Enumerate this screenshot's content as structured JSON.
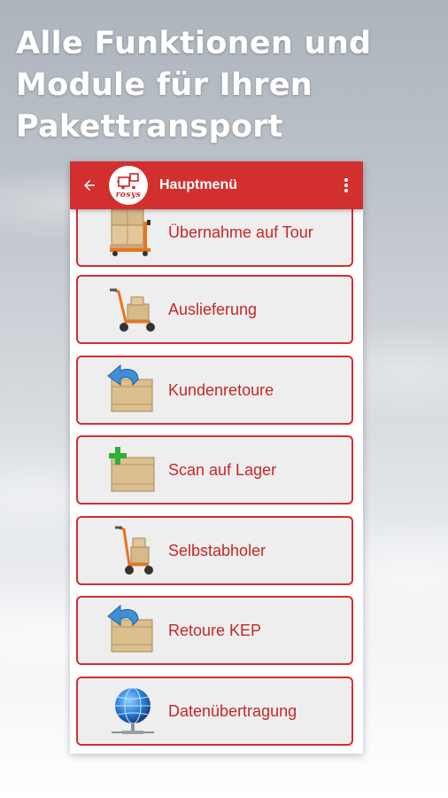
{
  "headline": "Alle Funktionen und Module für Ihren Pakettransport",
  "appbar": {
    "title": "Hauptmenü",
    "logo_text": "rosys",
    "back_icon": "arrow-left-icon",
    "overflow_icon": "more-vertical-icon"
  },
  "colors": {
    "accent": "#d32f2f",
    "label": "#c62828",
    "item_bg": "#eeeeee"
  },
  "menu": {
    "items": [
      {
        "label": "Übernahme auf Tour",
        "icon": "pallet-jack-boxes-icon"
      },
      {
        "label": "Auslieferung",
        "icon": "hand-truck-icon"
      },
      {
        "label": "Kundenretoure",
        "icon": "box-return-arrow-icon"
      },
      {
        "label": "Scan auf Lager",
        "icon": "box-add-plus-icon"
      },
      {
        "label": "Selbstabholer",
        "icon": "hand-truck-icon"
      },
      {
        "label": "Retoure KEP",
        "icon": "box-return-arrow-icon"
      },
      {
        "label": "Datenübertragung",
        "icon": "globe-network-icon"
      }
    ]
  }
}
